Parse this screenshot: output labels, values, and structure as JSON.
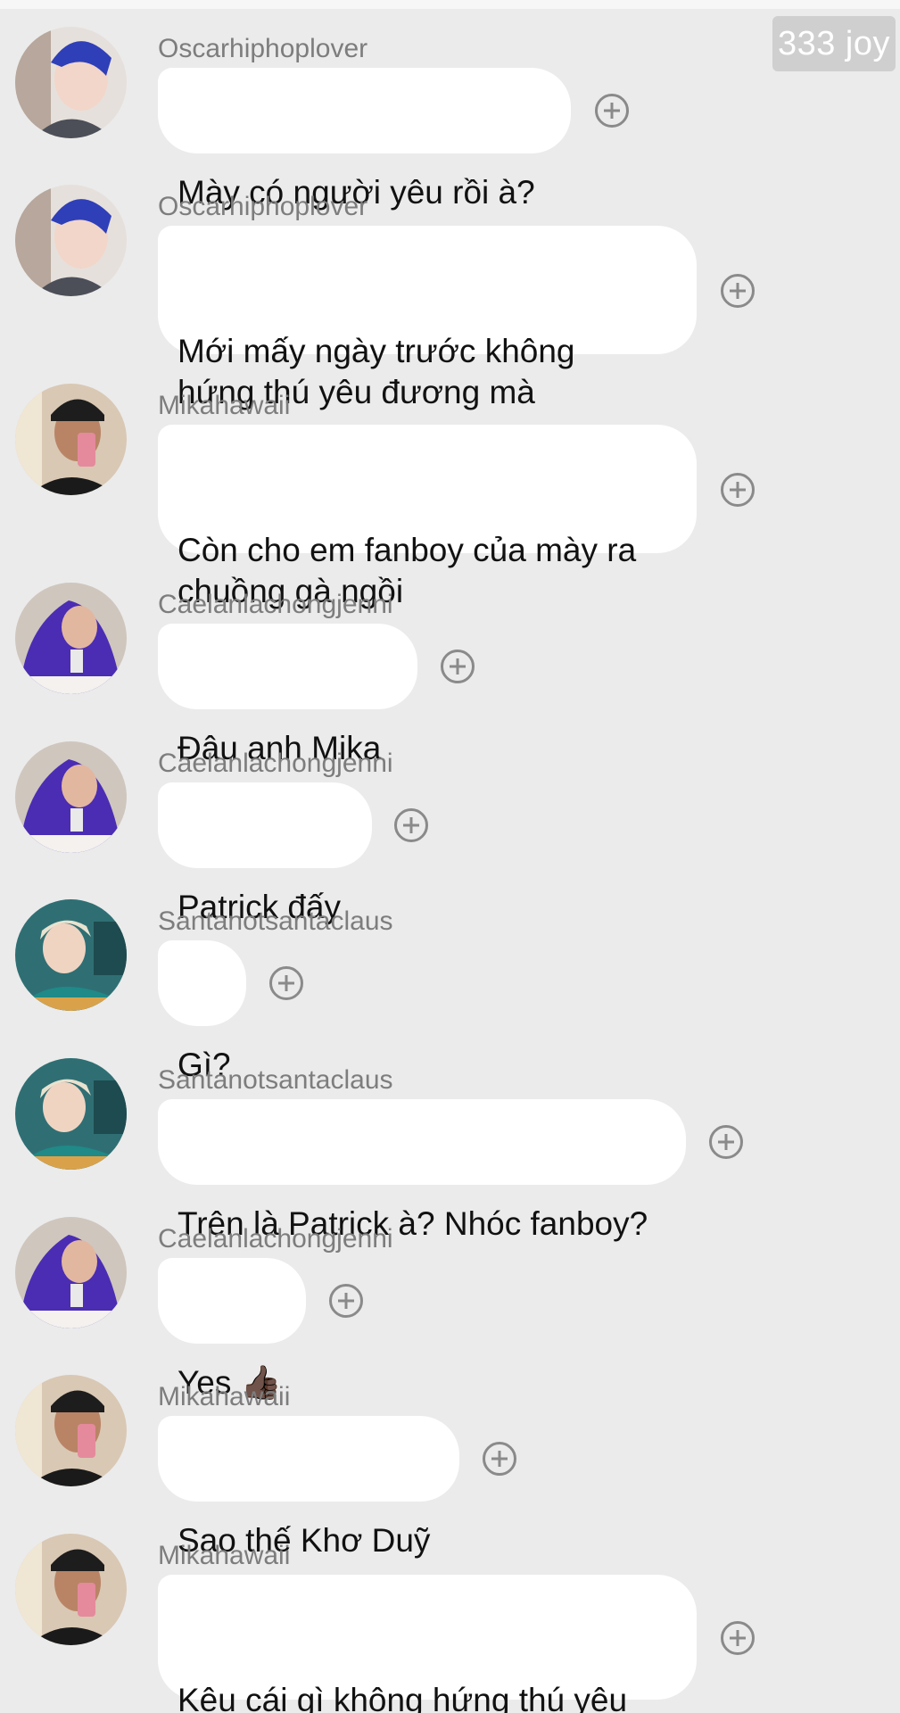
{
  "header": {
    "badge_text": "333 joy"
  },
  "messages": [
    {
      "username": "Oscarhiphoplover",
      "text": "Mày có người yêu rồi à?",
      "avatar": "user-avatar-oscar"
    },
    {
      "username": "Oscarhiphoplover",
      "text": "Mới mấy ngày trước không\nhứng thú yêu đương mà",
      "avatar": "user-avatar-oscar"
    },
    {
      "username": "Mikahawaii",
      "text": "Còn cho em fanboy của mày ra\nchuồng gà ngồi",
      "avatar": "user-avatar-mika"
    },
    {
      "username": "Caelanlachongjenni",
      "text": "Đâu anh Mika",
      "avatar": "user-avatar-caelan"
    },
    {
      "username": "Caelanlachongjenni",
      "text": "Patrick đấy",
      "avatar": "user-avatar-caelan"
    },
    {
      "username": "Santanotsantaclaus",
      "text": "Gì?",
      "avatar": "user-avatar-santa"
    },
    {
      "username": "Santanotsantaclaus",
      "text": "Trên là Patrick à? Nhóc fanboy?",
      "avatar": "user-avatar-santa"
    },
    {
      "username": "Caelanlachongjenni",
      "text": "Yes 👍🏿",
      "avatar": "user-avatar-caelan"
    },
    {
      "username": "Mikahawaii",
      "text": "Sao thế Khơ Duỹ",
      "avatar": "user-avatar-mika"
    },
    {
      "username": "Mikahawaii",
      "text": "Kêu cái gì không hứng thú yêu\nđương",
      "avatar": "user-avatar-mika"
    }
  ],
  "colors": {
    "background": "#ebebeb",
    "bubble": "#ffffff",
    "username": "#7d7d7d",
    "badge": "#cfcfcf"
  },
  "icons": {
    "reaction_button": "add-circle-icon"
  }
}
